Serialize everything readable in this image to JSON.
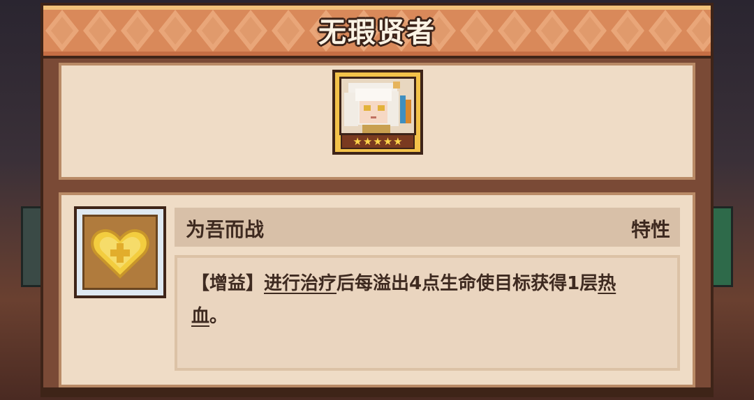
{
  "dialog": {
    "title": "无瑕贤者"
  },
  "character": {
    "portrait_icon": "character-portrait",
    "stars": [
      "★",
      "★",
      "★",
      "★",
      "★"
    ]
  },
  "trait": {
    "icon": "heart-plus-icon",
    "name": "为吾而战",
    "type": "特性",
    "description": {
      "tag": "【增益】",
      "kw1": "进行治疗",
      "text1": "后每溢出4点生命使目标获得1层",
      "kw2": "热血",
      "text2": "。"
    }
  },
  "colors": {
    "header_orange": "#d9895a",
    "panel_brown": "#7a4a36",
    "parchment": "#efdcc6",
    "star_gold": "#ffd54a"
  }
}
